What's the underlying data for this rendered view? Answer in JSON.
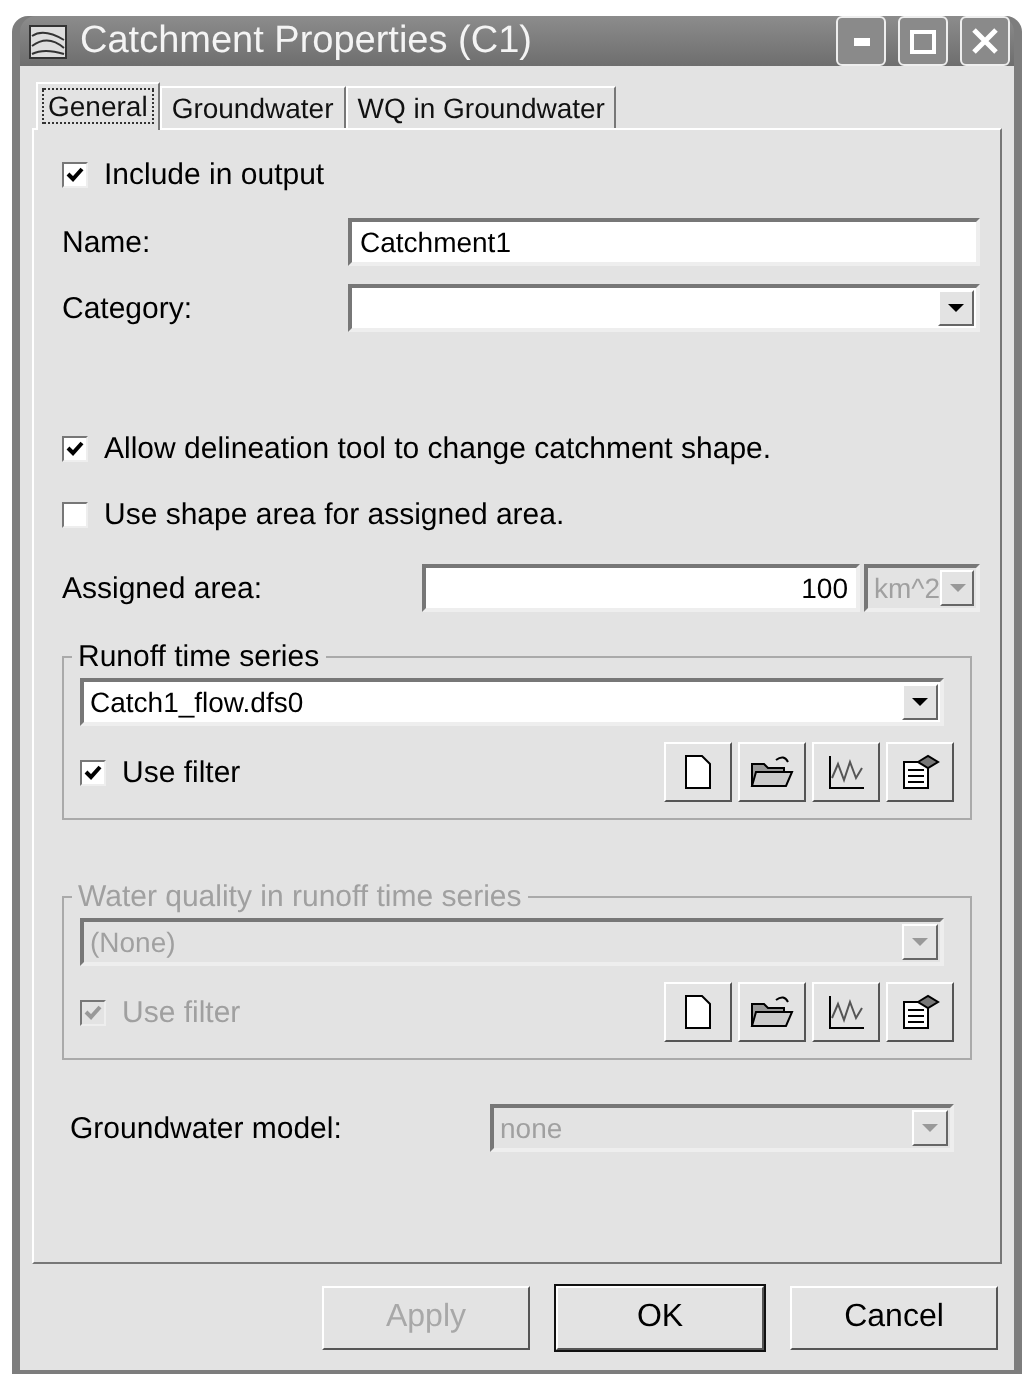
{
  "window": {
    "title": "Catchment Properties (C1)"
  },
  "tabs": [
    {
      "label": "General",
      "selected": true
    },
    {
      "label": "Groundwater",
      "selected": false
    },
    {
      "label": "WQ in Groundwater",
      "selected": false
    }
  ],
  "include_output": {
    "label": "Include in output",
    "checked": true
  },
  "name": {
    "label": "Name:",
    "value": "Catchment1"
  },
  "category": {
    "label": "Category:"
  },
  "options": [
    {
      "label": "Allow delineation tool to change catchment shape.",
      "checked": true
    },
    {
      "label": "Use shape area for assigned area.",
      "checked": false
    }
  ],
  "assigned_area": {
    "label": "Assigned area:",
    "value": "100",
    "unit": "km^2",
    "unit_disabled": true
  },
  "groups": [
    {
      "title": "Runoff time series",
      "disabled": false,
      "selection": "Catch1_flow.dfs0",
      "use_filter": {
        "label": "Use filter",
        "checked": true
      }
    },
    {
      "title": "Water quality in runoff time series",
      "disabled": true,
      "selection": "(None)",
      "use_filter": {
        "label": "Use filter",
        "checked": true
      }
    }
  ],
  "groundwater_model": {
    "label": "Groundwater model:",
    "value": "none",
    "disabled": true
  },
  "buttons": [
    {
      "label": "Apply",
      "disabled": true,
      "default": false
    },
    {
      "label": "OK",
      "disabled": false,
      "default": true
    },
    {
      "label": "Cancel",
      "disabled": false,
      "default": false
    }
  ]
}
